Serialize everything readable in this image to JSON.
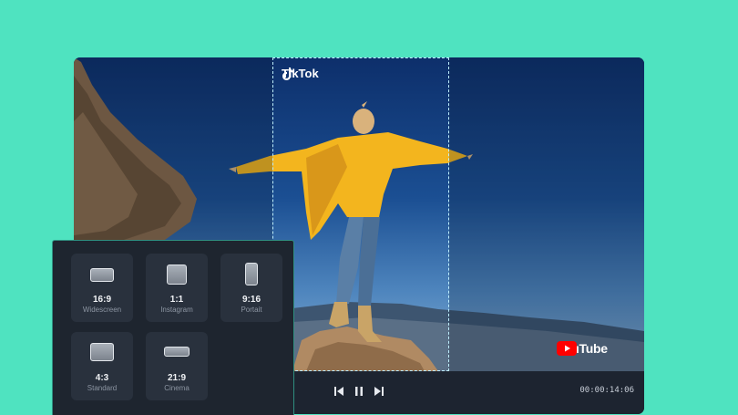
{
  "overlay": {
    "tiktok_label": "TikTok",
    "youtube_label": "YouTube"
  },
  "player": {
    "timecode": "00:00:14:06",
    "controls": {
      "previous_icon": "step-back-icon",
      "pause_icon": "pause-icon",
      "next_icon": "step-forward-icon"
    }
  },
  "aspect_ratios": [
    {
      "ratio": "16:9",
      "label": "Widescreen",
      "icon": "widescreen-icon"
    },
    {
      "ratio": "1:1",
      "label": "Instagram",
      "icon": "square-icon"
    },
    {
      "ratio": "9:16",
      "label": "Portait",
      "icon": "portrait-icon"
    },
    {
      "ratio": "4:3",
      "label": "Standard",
      "icon": "standard-icon"
    },
    {
      "ratio": "21:9",
      "label": "Cinema",
      "icon": "cinema-icon"
    }
  ],
  "colors": {
    "background": "#4fe3c0",
    "panel": "#1e252f",
    "tile": "#29313d",
    "accent": "#2f8f80",
    "youtube_red": "#ff0000"
  }
}
